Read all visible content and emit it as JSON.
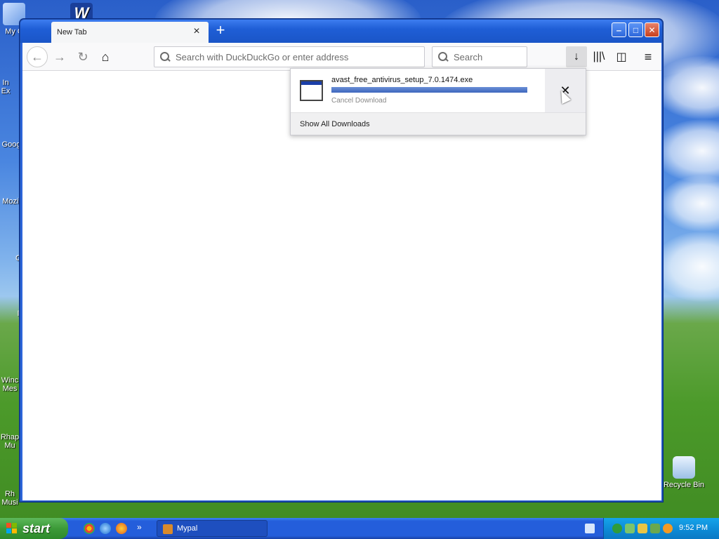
{
  "desktop": {
    "icons": [
      {
        "label": "My C"
      },
      {
        "label": "In\nEx"
      },
      {
        "label": "Goog"
      },
      {
        "label": "Mozil"
      },
      {
        "label": "C"
      },
      {
        "label": "I"
      },
      {
        "label": "Winc\nMes"
      },
      {
        "label": "Rhap\nMu"
      },
      {
        "label": "Rh\nMusi"
      },
      {
        "label": "Recycle Bin"
      }
    ]
  },
  "browser": {
    "tab": {
      "title": "New Tab",
      "close_glyph": "×"
    },
    "new_tab_glyph": "+",
    "window_controls": {
      "minimize": "‒",
      "maximize": "□",
      "close": "✕"
    },
    "nav": {
      "back_glyph": "←",
      "forward_glyph": "→",
      "reload_glyph": "↻",
      "home_glyph": "⌂"
    },
    "urlbar": {
      "placeholder": "Search with DuckDuckGo or enter address"
    },
    "searchbar": {
      "placeholder": "Search"
    },
    "toolbar": {
      "downloads_glyph": "↓",
      "library_glyph": "|||\\",
      "sidebar_glyph": "◫",
      "menu_glyph": "≡"
    }
  },
  "downloads_panel": {
    "items": [
      {
        "filename": "avast_free_antivirus_setup_7.0.1474.exe",
        "status": "Cancel Download",
        "progress_percent": 100,
        "cancel_glyph": "✕"
      }
    ],
    "footer_label": "Show All Downloads"
  },
  "taskbar": {
    "start_label": "start",
    "quick_launch_more": "»",
    "task_items": [
      {
        "label": "Mypal"
      }
    ],
    "clock": "9:52 PM"
  },
  "colors": {
    "taskbar_blue": "#245edb",
    "start_green": "#3c9a38",
    "tray_blue": "#0d8cd8",
    "progress_blue": "#3d66bd"
  }
}
